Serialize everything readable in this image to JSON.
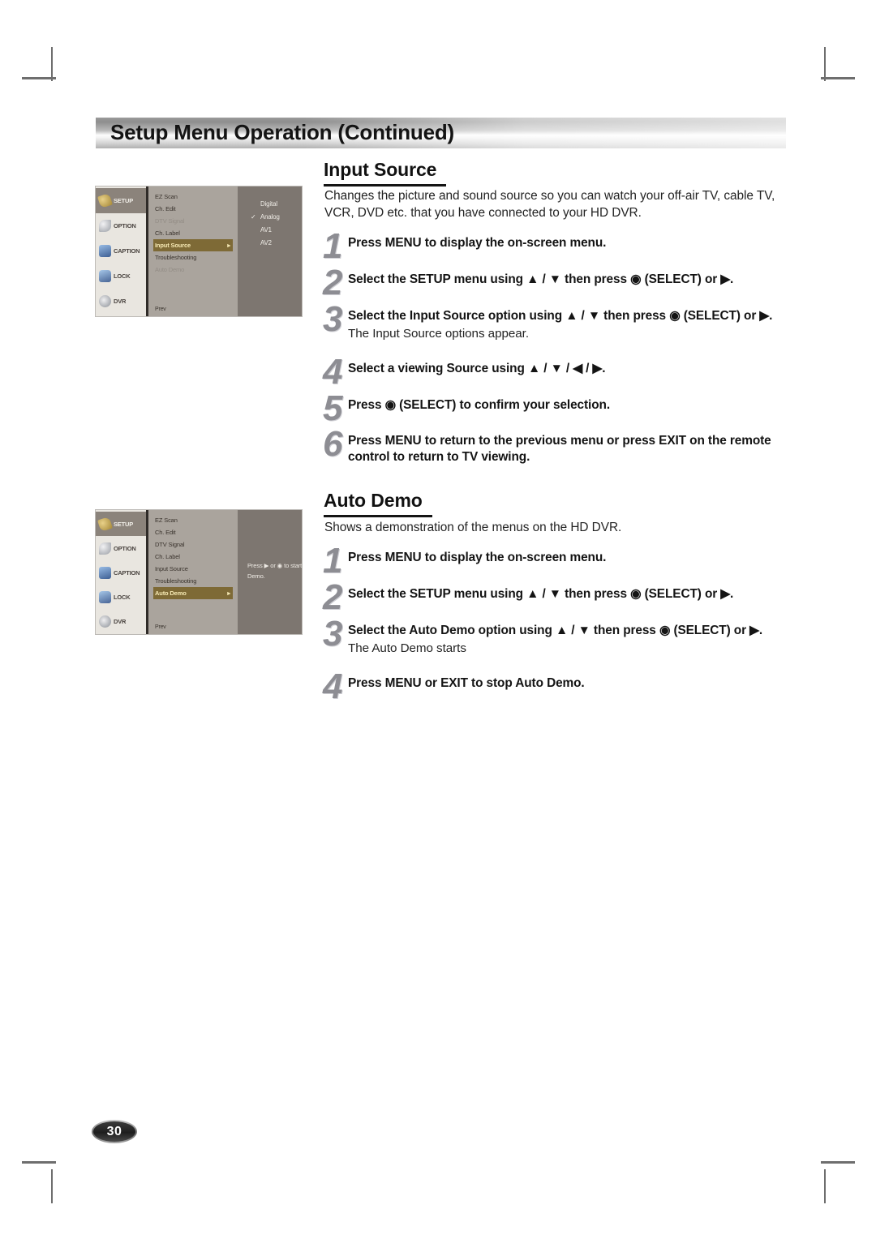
{
  "page": {
    "title": "Setup Menu Operation (Continued)",
    "number": "30"
  },
  "sections": [
    {
      "heading": "Input Source",
      "intro": "Changes the picture and sound source so you can watch your off-air TV, cable TV, VCR, DVD etc. that you have connected to your HD DVR.",
      "steps": [
        {
          "num": "1",
          "title": "Press MENU to display the on-screen menu.",
          "note": ""
        },
        {
          "num": "2",
          "title": "Select the SETUP menu using ▲ / ▼ then press ◉ (SELECT) or ▶.",
          "note": ""
        },
        {
          "num": "3",
          "title": "Select the Input Source option using ▲ / ▼ then press ◉ (SELECT) or ▶.",
          "note": "The Input Source options appear."
        },
        {
          "num": "4",
          "title": "Select a viewing Source using ▲ / ▼ / ◀ / ▶.",
          "note": ""
        },
        {
          "num": "5",
          "title": "Press ◉ (SELECT) to confirm your selection.",
          "note": ""
        },
        {
          "num": "6",
          "title": "Press MENU to return to the previous menu or press EXIT on the remote control to return to TV viewing.",
          "note": ""
        }
      ]
    },
    {
      "heading": "Auto Demo",
      "intro": "Shows a demonstration of the menus on the HD DVR.",
      "steps": [
        {
          "num": "1",
          "title": "Press MENU to display the on-screen menu.",
          "note": ""
        },
        {
          "num": "2",
          "title": "Select the SETUP menu using ▲ / ▼ then press ◉ (SELECT) or ▶.",
          "note": ""
        },
        {
          "num": "3",
          "title": "Select the Auto Demo  option using ▲ / ▼ then press ◉ (SELECT) or ▶.",
          "note": "The Auto Demo starts"
        },
        {
          "num": "4",
          "title": "Press MENU or EXIT to stop Auto Demo.",
          "note": ""
        }
      ]
    }
  ],
  "osd_input_source": {
    "sidebar": [
      {
        "label": "SETUP",
        "icon": "wrench-icon"
      },
      {
        "label": "OPTION",
        "icon": "checkmark-icon"
      },
      {
        "label": "CAPTION",
        "icon": "caption-icon"
      },
      {
        "label": "LOCK",
        "icon": "lock-icon"
      },
      {
        "label": "DVR",
        "icon": "disc-icon"
      }
    ],
    "menu_items": [
      {
        "label": "EZ Scan",
        "state": "normal"
      },
      {
        "label": "Ch. Edit",
        "state": "normal"
      },
      {
        "label": "DTV Signal",
        "state": "dim"
      },
      {
        "label": "Ch. Label",
        "state": "normal"
      },
      {
        "label": "Input Source",
        "state": "selected"
      },
      {
        "label": "Troubleshooting",
        "state": "normal"
      },
      {
        "label": "Auto Demo",
        "state": "dim"
      }
    ],
    "options": [
      {
        "label": "Digital",
        "checked": false
      },
      {
        "label": "Analog",
        "checked": true
      },
      {
        "label": "AV1",
        "checked": false
      },
      {
        "label": "AV2",
        "checked": false
      }
    ],
    "footer": "Prev",
    "hint": ""
  },
  "osd_auto_demo": {
    "sidebar": [
      {
        "label": "SETUP",
        "icon": "wrench-icon"
      },
      {
        "label": "OPTION",
        "icon": "checkmark-icon"
      },
      {
        "label": "CAPTION",
        "icon": "caption-icon"
      },
      {
        "label": "LOCK",
        "icon": "lock-icon"
      },
      {
        "label": "DVR",
        "icon": "disc-icon"
      }
    ],
    "menu_items": [
      {
        "label": "EZ Scan",
        "state": "normal"
      },
      {
        "label": "Ch. Edit",
        "state": "normal"
      },
      {
        "label": "DTV Signal",
        "state": "normal"
      },
      {
        "label": "Ch. Label",
        "state": "normal"
      },
      {
        "label": "Input Source",
        "state": "normal"
      },
      {
        "label": "Troubleshooting",
        "state": "normal"
      },
      {
        "label": "Auto Demo",
        "state": "selected"
      }
    ],
    "options": [],
    "footer": "Prev",
    "hint": "Press ▶ or ◉ to start Auto Demo."
  }
}
